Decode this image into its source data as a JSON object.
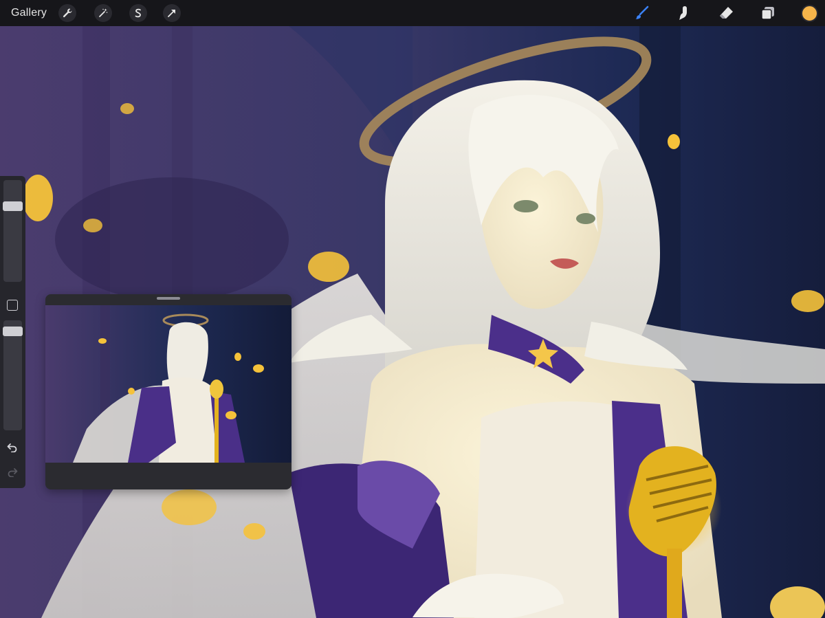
{
  "toolbar": {
    "gallery_label": "Gallery",
    "left_tools": [
      "wrench-icon",
      "magic-wand-icon",
      "selection-s-icon",
      "transform-arrow-icon"
    ],
    "right_tools": [
      "brush-icon",
      "smudge-icon",
      "eraser-icon",
      "layers-icon"
    ],
    "active_tool": "brush-icon",
    "current_color": "#f7b54a",
    "brush_active_color": "#3b82f6"
  },
  "sidebar": {
    "size_slider_level": 0.77,
    "opacity_slider_level": 0.94,
    "undo_icon": "undo-arrow-icon",
    "redo_icon": "redo-arrow-icon"
  },
  "reference_window": {
    "content": "reference-image"
  },
  "canvas": {
    "background_colors": [
      "#4a3b6b",
      "#1e2a52",
      "#16203f"
    ],
    "accent_gold": "#f3c64a",
    "dress_purple": "#4b2f8a",
    "hair_color": "#efeadf"
  }
}
